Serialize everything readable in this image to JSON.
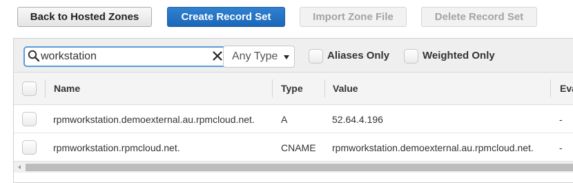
{
  "toolbar": {
    "back_label": "Back to Hosted Zones",
    "create_label": "Create Record Set",
    "import_label": "Import Zone File",
    "delete_label": "Delete Record Set"
  },
  "filters": {
    "search_value": "workstation",
    "type_select": "Any Type",
    "aliases_only": "Aliases Only",
    "weighted_only": "Weighted Only"
  },
  "table": {
    "columns": [
      "Name",
      "Type",
      "Value",
      "Eva"
    ],
    "rows": [
      {
        "name": "rpmworkstation.demoexternal.au.rpmcloud.net.",
        "type": "A",
        "value": "52.64.4.196",
        "eval": "-"
      },
      {
        "name": "rpmworkstation.rpmcloud.net.",
        "type": "CNAME",
        "value": "rpmworkstation.demoexternal.au.rpmcloud.net.",
        "eval": "-"
      }
    ]
  },
  "colors": {
    "primary": "#1f6dbd",
    "focus": "#5b9bd5"
  }
}
